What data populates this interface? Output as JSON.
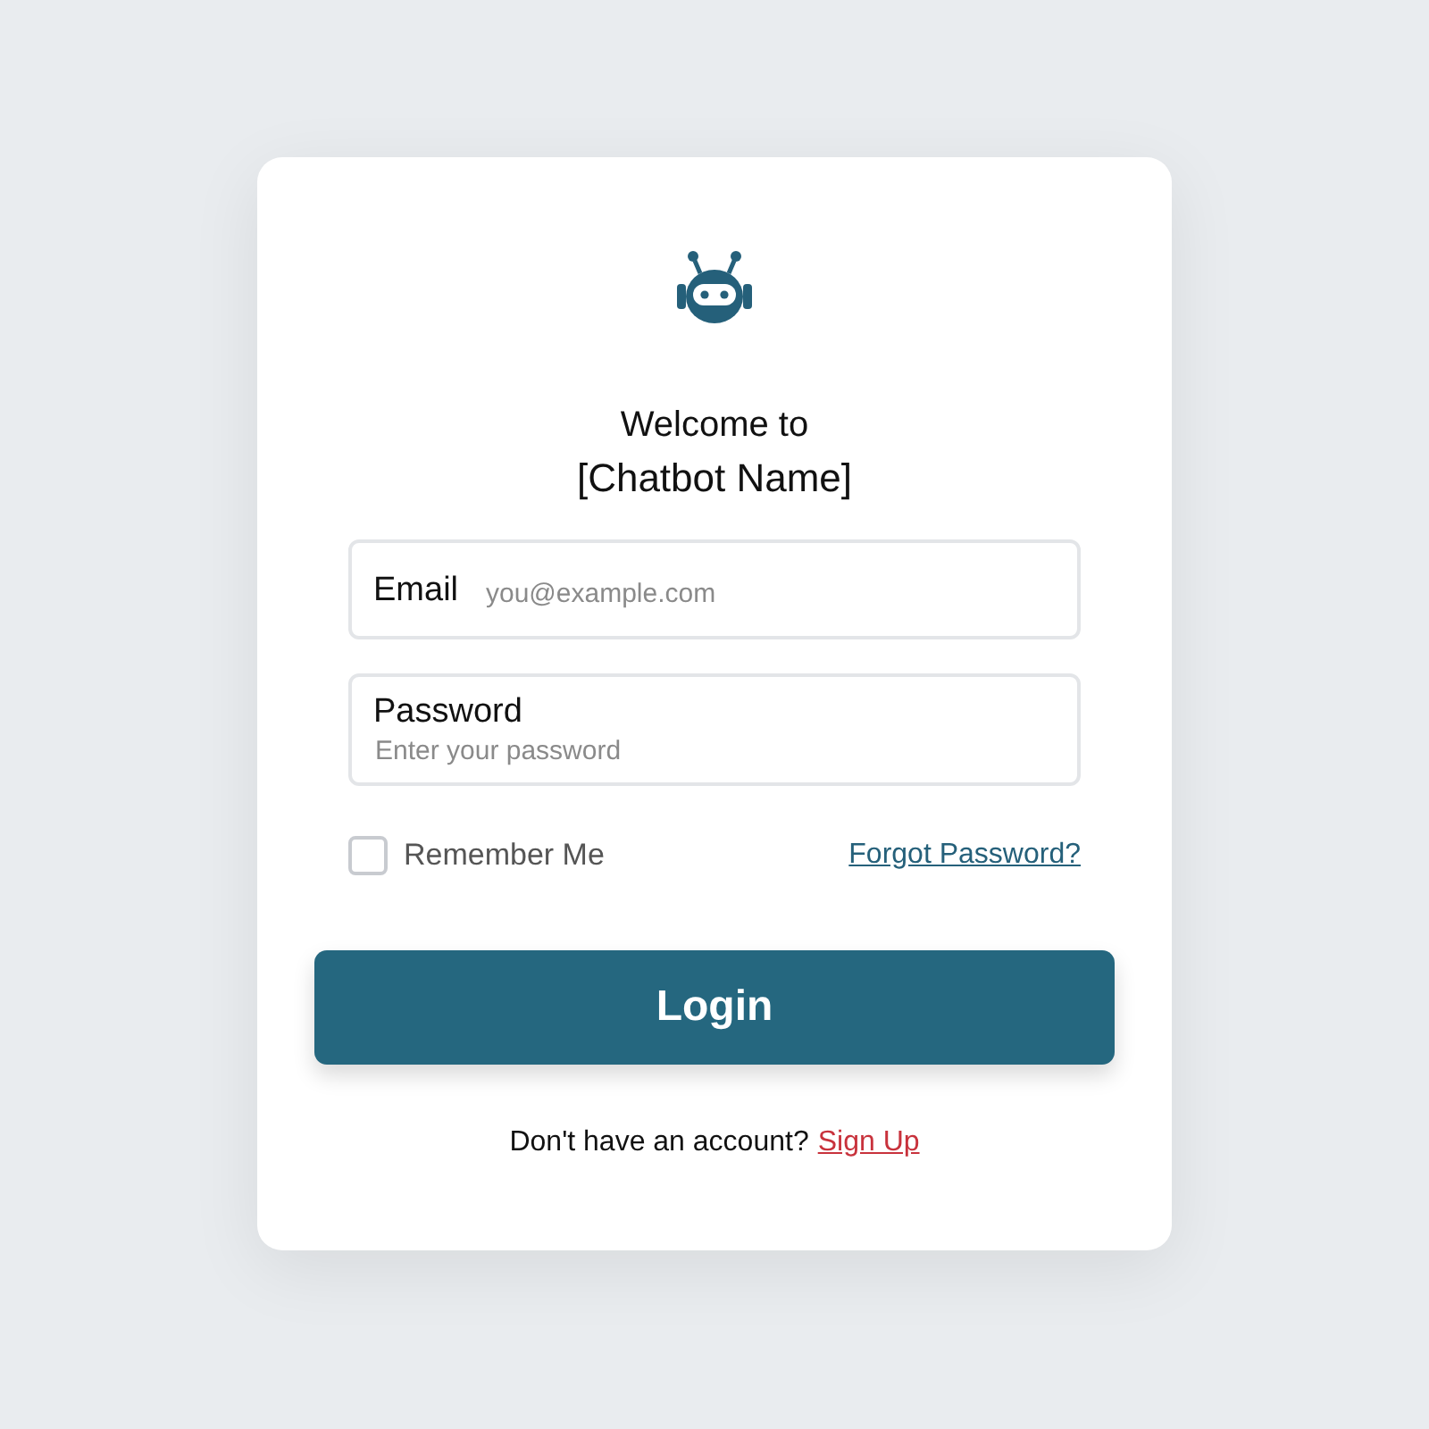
{
  "header": {
    "title_line_1": "Welcome to",
    "title_line_2": "[Chatbot Name]"
  },
  "fields": [
    {
      "kind": "inline",
      "label": "Email",
      "placeholder": "you@example.com"
    },
    {
      "kind": "stacked",
      "label": "Password",
      "placeholder": "Enter your password"
    }
  ],
  "remember": {
    "label": "Remember Me",
    "checked": false
  },
  "forgot_link": "Forgot Password?",
  "login_button": "Login",
  "footer": {
    "text": "Don't have an account?",
    "link": "Sign Up"
  }
}
